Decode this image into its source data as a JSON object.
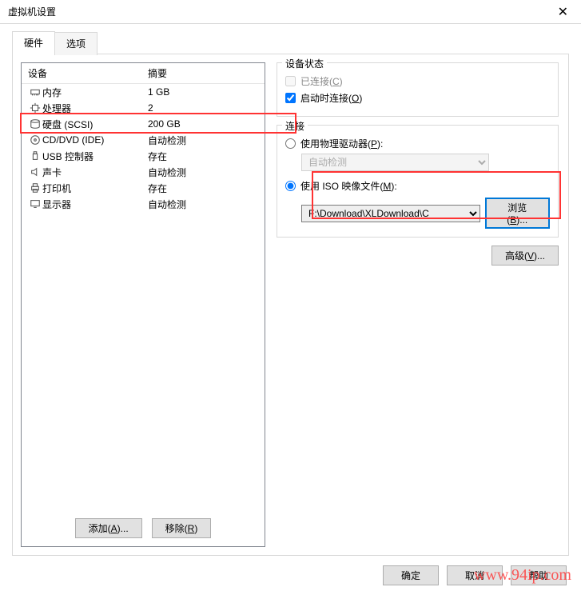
{
  "title": "虚拟机设置",
  "tabs": {
    "hardware": "硬件",
    "options": "选项"
  },
  "columns": {
    "device": "设备",
    "summary": "摘要"
  },
  "devices": [
    {
      "icon": "memory-icon",
      "name": "内存",
      "summary": "1 GB"
    },
    {
      "icon": "cpu-icon",
      "name": "处理器",
      "summary": "2"
    },
    {
      "icon": "disk-icon",
      "name": "硬盘 (SCSI)",
      "summary": "200 GB"
    },
    {
      "icon": "cd-icon",
      "name": "CD/DVD (IDE)",
      "summary": "自动检测"
    },
    {
      "icon": "usb-icon",
      "name": "USB 控制器",
      "summary": "存在"
    },
    {
      "icon": "audio-icon",
      "name": "声卡",
      "summary": "自动检测"
    },
    {
      "icon": "printer-icon",
      "name": "打印机",
      "summary": "存在"
    },
    {
      "icon": "display-icon",
      "name": "显示器",
      "summary": "自动检测"
    }
  ],
  "buttons": {
    "add": "添加(A)...",
    "remove": "移除(R)",
    "ok": "确定",
    "cancel": "取消",
    "help": "帮助",
    "browse": "浏览(B)...",
    "advanced": "高级(V)..."
  },
  "device_status": {
    "legend": "设备状态",
    "connected": "已连接(C)",
    "connect_on_power": "启动时连接(O)"
  },
  "connection": {
    "legend": "连接",
    "physical": "使用物理驱动器(P):",
    "physical_value": "自动检测",
    "iso": "使用 ISO 映像文件(M):",
    "iso_path": "F:\\Download\\XLDownload\\C"
  },
  "watermark": "www.94ip.com"
}
